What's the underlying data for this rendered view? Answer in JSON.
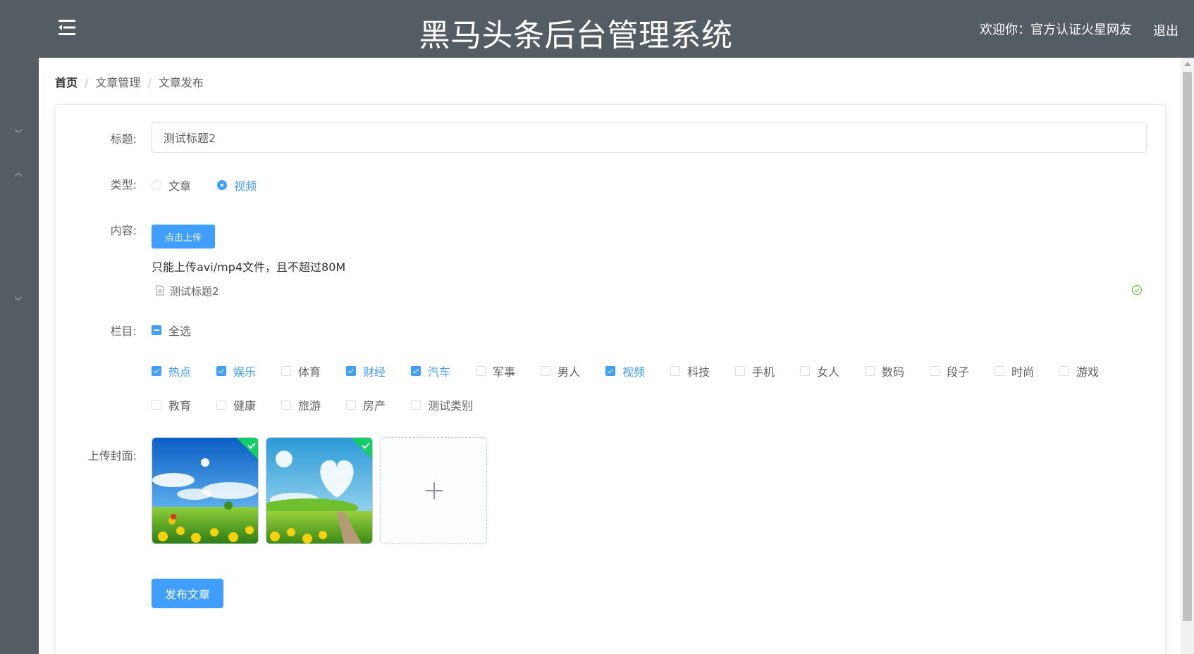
{
  "header": {
    "title": "黑马头条后台管理系统",
    "welcome": "欢迎你：官方认证火星网友",
    "logout": "退出"
  },
  "breadcrumb": {
    "home": "首页",
    "items": [
      "文章管理",
      "文章发布"
    ]
  },
  "form": {
    "title_label": "标题:",
    "title_value": "测试标题2",
    "type_label": "类型:",
    "type_options": [
      {
        "label": "文章",
        "checked": false
      },
      {
        "label": "视频",
        "checked": true
      }
    ],
    "content_label": "内容:",
    "upload_button": "点击上传",
    "upload_tip": "只能上传avi/mp4文件，且不超过80M",
    "uploaded_file": "测试标题2",
    "channel_label": "栏目:",
    "select_all": "全选",
    "channels": [
      {
        "label": "热点",
        "checked": true
      },
      {
        "label": "娱乐",
        "checked": true
      },
      {
        "label": "体育",
        "checked": false
      },
      {
        "label": "财经",
        "checked": true
      },
      {
        "label": "汽车",
        "checked": true
      },
      {
        "label": "军事",
        "checked": false
      },
      {
        "label": "男人",
        "checked": false
      },
      {
        "label": "视频",
        "checked": true
      },
      {
        "label": "科技",
        "checked": false
      },
      {
        "label": "手机",
        "checked": false
      },
      {
        "label": "女人",
        "checked": false
      },
      {
        "label": "数码",
        "checked": false
      },
      {
        "label": "段子",
        "checked": false
      },
      {
        "label": "时尚",
        "checked": false
      },
      {
        "label": "游戏",
        "checked": false
      },
      {
        "label": "教育",
        "checked": false
      },
      {
        "label": "健康",
        "checked": false
      },
      {
        "label": "旅游",
        "checked": false
      },
      {
        "label": "房产",
        "checked": false
      },
      {
        "label": "测试类别",
        "checked": false
      }
    ],
    "cover_label": "上传封面:",
    "publish_button": "发布文章"
  },
  "colors": {
    "header_bg": "#545c64",
    "primary": "#409eff",
    "success": "#13ce66"
  },
  "icons": {
    "menu_toggle": "menu-fold-icon",
    "file": "document-icon",
    "success": "circle-check-icon",
    "add": "plus-icon"
  }
}
